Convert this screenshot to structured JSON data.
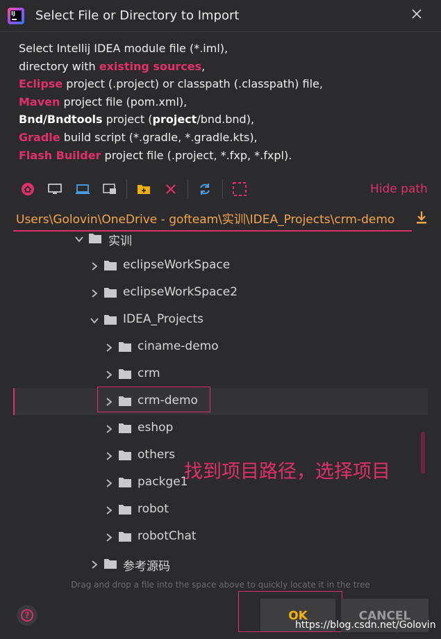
{
  "window": {
    "title": "Select File or Directory to Import",
    "app_icon_text": "IJ"
  },
  "description": {
    "line1": "Select Intellij IDEA module file (*.iml),",
    "line2_pre": "directory with ",
    "line2_hl": "existing sources",
    "line2_post": ",",
    "line3_hl": "Eclipse",
    "line3_post": " project (.project) or classpath (.classpath) file,",
    "line4_hl": "Maven",
    "line4_post": " project file (pom.xml),",
    "line5_b1": "Bnd/Bndtools",
    "line5_mid": " project (",
    "line5_b2": "project",
    "line5_post": "/bnd.bnd),",
    "line6_hl": "Gradle",
    "line6_post": " build script (*.gradle, *.gradle.kts),",
    "line7_hl": "Flash Builder",
    "line7_post": " project file (.project, *.fxp, *.fxpl)."
  },
  "toolbar": {
    "icons": [
      "home-icon",
      "desktop-icon",
      "project-icon",
      "module-icon",
      "new-folder-icon",
      "delete-icon",
      "refresh-icon",
      "select-icon"
    ],
    "hide_path_label": "Hide path"
  },
  "path": {
    "value": "Users\\Golovin\\OneDrive - gofteam\\实训\\IDEA_Projects\\crm-demo"
  },
  "tree": {
    "rows": [
      {
        "label": "实训",
        "depth": 0,
        "expanded": true
      },
      {
        "label": "eclipseWorkSpace",
        "depth": 1,
        "expanded": false
      },
      {
        "label": "eclipseWorkSpace2",
        "depth": 1,
        "expanded": false
      },
      {
        "label": "IDEA_Projects",
        "depth": 1,
        "expanded": true
      },
      {
        "label": "ciname-demo",
        "depth": 2,
        "expanded": false
      },
      {
        "label": "crm",
        "depth": 2,
        "expanded": false
      },
      {
        "label": "crm-demo",
        "depth": 2,
        "expanded": false,
        "selected": true
      },
      {
        "label": "eshop",
        "depth": 2,
        "expanded": false
      },
      {
        "label": "others",
        "depth": 2,
        "expanded": false
      },
      {
        "label": "packge1",
        "depth": 2,
        "expanded": false
      },
      {
        "label": "robot",
        "depth": 2,
        "expanded": false
      },
      {
        "label": "robotChat",
        "depth": 2,
        "expanded": false
      },
      {
        "label": "参考源码",
        "depth": 1,
        "expanded": false
      }
    ]
  },
  "annotation": {
    "text": "找到项目路径，选择项目"
  },
  "hint": "Drag and drop a file into the space above to quickly locate it in the tree",
  "buttons": {
    "ok": "OK",
    "cancel": "CANCEL"
  },
  "watermark": "https://blog.csdn.net/Golovin",
  "colors": {
    "accent": "#e0306a",
    "path_text": "#f3a64a",
    "ok_text": "#f5b400",
    "icon_blue": "#4aa3ea",
    "icon_yellow": "#f4b000",
    "icon_red": "#e0306a",
    "folder": "#c9c9cb"
  }
}
